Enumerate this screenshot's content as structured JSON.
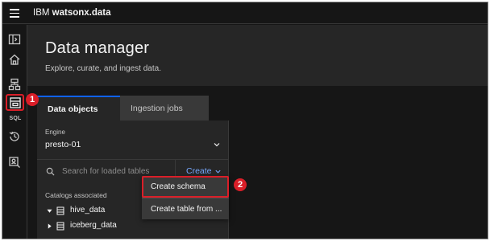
{
  "app": {
    "brand_prefix": "IBM",
    "brand_name": "watsonx.data"
  },
  "rail": {
    "icons": [
      "sidebar-toggle-icon",
      "home-icon",
      "infrastructure-icon",
      "data-manager-icon",
      "sql-icon",
      "history-icon",
      "access-control-icon"
    ],
    "sql_label": "SQL"
  },
  "header": {
    "title": "Data manager",
    "subtitle": "Explore, curate, and ingest data."
  },
  "tabs": [
    {
      "label": "Data objects",
      "selected": true
    },
    {
      "label": "Ingestion jobs",
      "selected": false
    }
  ],
  "engine": {
    "label": "Engine",
    "value": "presto-01"
  },
  "search": {
    "placeholder": "Search for loaded tables",
    "value": ""
  },
  "create": {
    "label": "Create"
  },
  "catalogs": {
    "label": "Catalogs associated",
    "items": [
      {
        "name": "hive_data",
        "expanded": true
      },
      {
        "name": "iceberg_data",
        "expanded": false
      }
    ]
  },
  "create_menu": {
    "items": [
      "Create schema",
      "Create table from ..."
    ]
  },
  "markers": [
    "1",
    "2"
  ],
  "colors": {
    "accent": "#0f62fe",
    "link": "#78a9ff",
    "highlight": "#da1e28"
  }
}
